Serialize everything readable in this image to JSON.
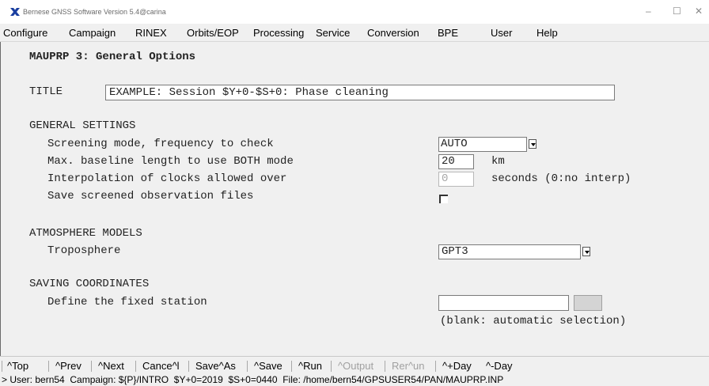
{
  "window": {
    "title": "Bernese GNSS Software Version 5.4@carina",
    "minimize": "–",
    "maximize": "☐",
    "close": "✕"
  },
  "menu": [
    {
      "label": "Configure"
    },
    {
      "label": "Campaign"
    },
    {
      "label": "RINEX"
    },
    {
      "label": "Orbits/EOP"
    },
    {
      "label": "Processing"
    },
    {
      "label": "Service"
    },
    {
      "label": "Conversion"
    },
    {
      "label": "BPE"
    },
    {
      "label": "User"
    },
    {
      "label": "Help"
    }
  ],
  "panel": {
    "title": "MAUPRP 3: General Options",
    "title_label": "TITLE",
    "title_value": "EXAMPLE: Session $Y+0-$S+0: Phase cleaning",
    "general": {
      "header": "GENERAL SETTINGS",
      "screening_label": "Screening mode, frequency to check",
      "screening_value": "AUTO",
      "baseline_label": "Max. baseline length to use BOTH mode",
      "baseline_value": "20",
      "baseline_unit": "km",
      "interp_label": "Interpolation of clocks allowed over",
      "interp_value": "0",
      "interp_unit": "seconds (0:no interp)",
      "save_label": "Save screened observation files",
      "save_checked": true
    },
    "atmosphere": {
      "header": "ATMOSPHERE MODELS",
      "tropo_label": "Troposphere",
      "tropo_value": "GPT3"
    },
    "saving": {
      "header": "SAVING COORDINATES",
      "fixed_label": "Define the fixed station",
      "fixed_value": "",
      "fixed_hint": "(blank: automatic selection)"
    }
  },
  "bottom_buttons": [
    {
      "label": "^Top",
      "enabled": true
    },
    {
      "label": "^Prev",
      "enabled": true
    },
    {
      "label": "^Next",
      "enabled": true
    },
    {
      "label": "Cance^l",
      "enabled": true
    },
    {
      "label": "Save^As",
      "enabled": true
    },
    {
      "label": "^Save",
      "enabled": true
    },
    {
      "label": "^Run",
      "enabled": true
    },
    {
      "label": "^Output",
      "enabled": false
    },
    {
      "label": "Rer^un",
      "enabled": false
    },
    {
      "label": "^+Day",
      "enabled": true
    },
    {
      "label": "^-Day",
      "enabled": true
    }
  ],
  "status": "> User: bern54  Campaign: ${P}/INTRO  $Y+0=2019  $S+0=0440  File: /home/bern54/GPSUSER54/PAN/MAUPRP.INP"
}
